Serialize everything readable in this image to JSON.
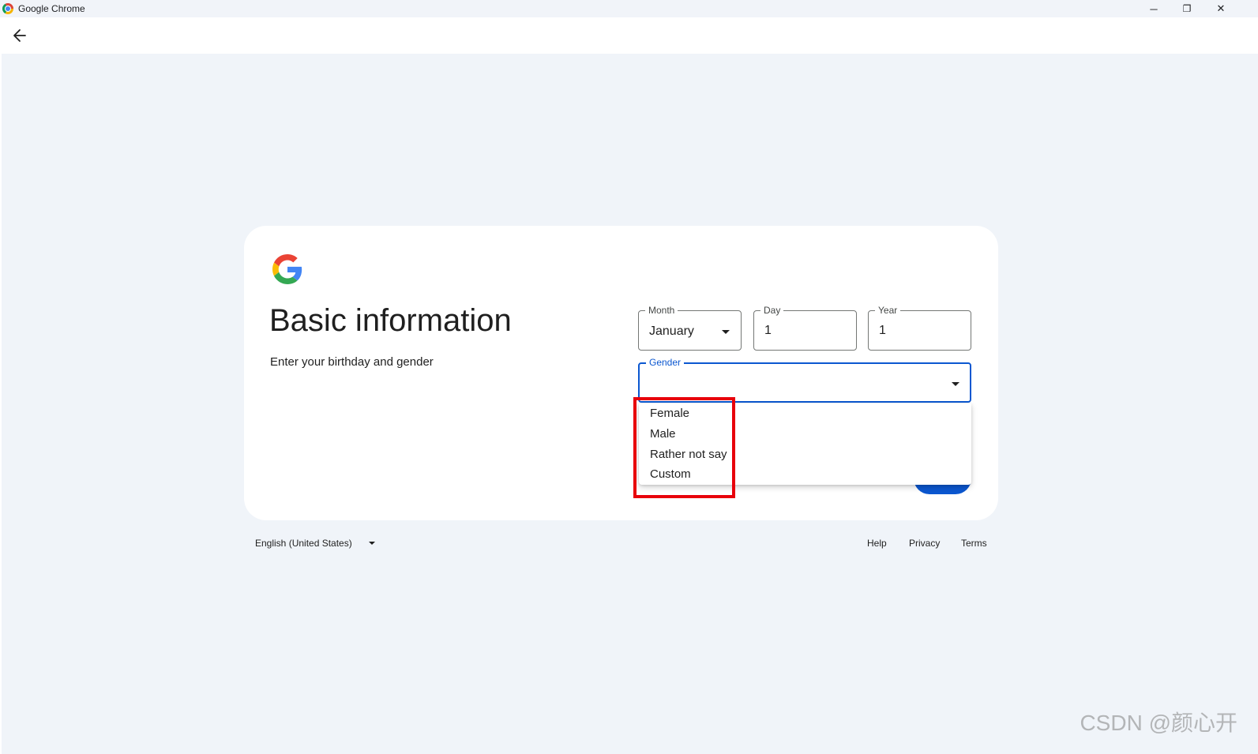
{
  "window": {
    "app_title": "Google Chrome",
    "minimize_glyph": "─",
    "restore_glyph": "❐",
    "close_glyph": "✕"
  },
  "form": {
    "heading": "Basic information",
    "subheading": "Enter your birthday and gender",
    "month": {
      "label": "Month",
      "value": "January"
    },
    "day": {
      "label": "Day",
      "value": "1"
    },
    "year": {
      "label": "Year",
      "value": "1"
    },
    "gender": {
      "label": "Gender",
      "value": ""
    },
    "gender_options": [
      "Female",
      "Male",
      "Rather not say",
      "Custom"
    ]
  },
  "footer": {
    "language": "English (United States)",
    "links": [
      "Help",
      "Privacy",
      "Terms"
    ]
  },
  "watermark": "CSDN @颜心开",
  "colors": {
    "accent": "#0b57d0",
    "page_bg": "#f0f4f9",
    "highlight": "#e8000b"
  }
}
